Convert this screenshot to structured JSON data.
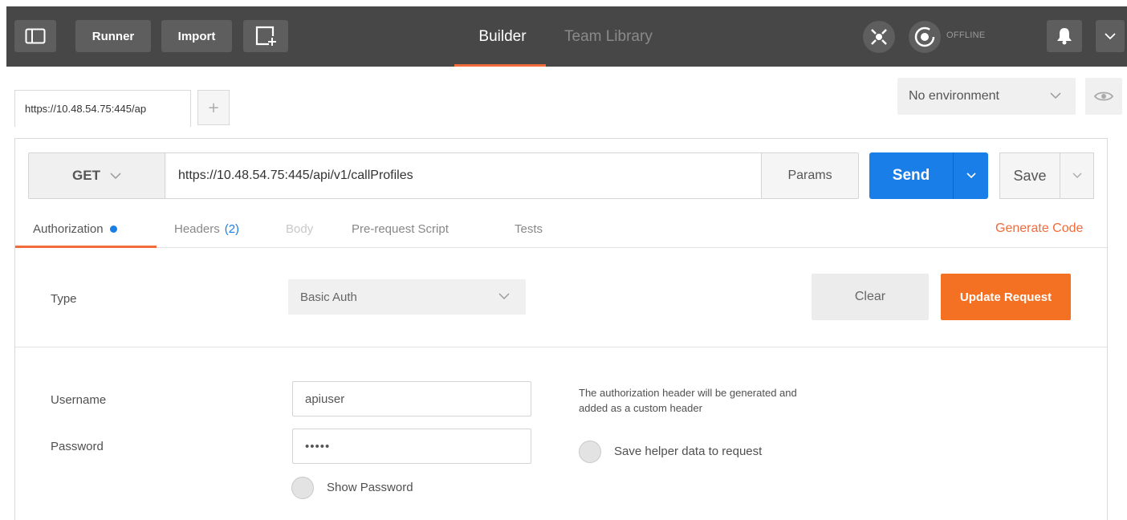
{
  "topbar": {
    "runner_label": "Runner",
    "import_label": "Import",
    "tabs": [
      {
        "label": "Builder",
        "active": true
      },
      {
        "label": "Team Library",
        "active": false
      }
    ],
    "sync_status": "OFFLINE",
    "colors": {
      "bg": "#474747",
      "accent": "#f26b3a"
    }
  },
  "request_tabs": {
    "current": "https://10.48.54.75:445/ap",
    "add_label": "+"
  },
  "environment": {
    "selected": "No environment"
  },
  "request": {
    "method": "GET",
    "url": "https://10.48.54.75:445/api/v1/callProfiles",
    "params_label": "Params",
    "send_label": "Send",
    "save_label": "Save",
    "colors": {
      "send": "#1a7ee8"
    }
  },
  "subtabs": {
    "authorization": "Authorization",
    "headers": "Headers",
    "headers_count": "(2)",
    "body": "Body",
    "prerequest": "Pre-request Script",
    "tests": "Tests",
    "generate_code": "Generate Code"
  },
  "auth": {
    "type_label": "Type",
    "type_value": "Basic Auth",
    "clear_label": "Clear",
    "update_label": "Update Request",
    "username_label": "Username",
    "username_value": "apiuser",
    "password_label": "Password",
    "password_value": "•••••",
    "show_password_label": "Show Password",
    "info_text_line1": "The authorization header will be generated and",
    "info_text_line2": "added as a custom header",
    "save_helper_label": "Save helper data to request",
    "colors": {
      "update": "#f47023"
    }
  }
}
